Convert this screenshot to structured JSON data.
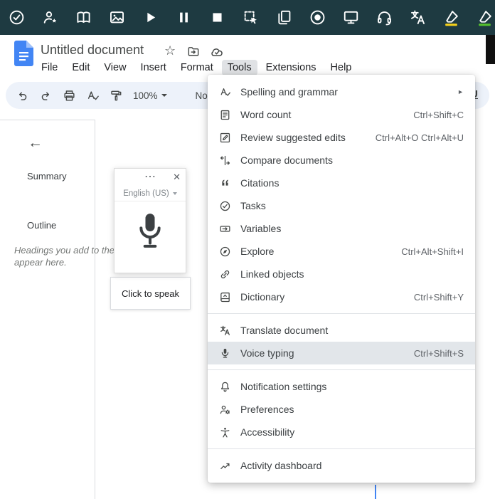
{
  "colors": {
    "topbar_bg": "#1e3a41",
    "docs_blue": "#4285f4",
    "toolbar_bg": "#edf2fa",
    "menu_item_highlight": "#e2e6ea",
    "active_menu_bg": "#e0e2e5",
    "highlighter_yellow": "#f7d21a",
    "highlighter_green": "#56c22d",
    "page_edge_blue": "#4285f4"
  },
  "top_toolbar": {
    "icons": [
      "check-circle-icon",
      "person-star-icon",
      "book-icon",
      "image-icon",
      "play-icon",
      "pause-icon",
      "stop-icon",
      "select-area-icon",
      "copy-icon",
      "record-icon",
      "monitor-icon",
      "headset-icon",
      "translate-icon",
      "highlighter-yellow-icon",
      "highlighter-green-icon"
    ]
  },
  "header": {
    "title": "Untitled document",
    "menu_items": [
      "File",
      "Edit",
      "View",
      "Insert",
      "Format",
      "Tools",
      "Extensions",
      "Help"
    ],
    "active_menu": "Tools"
  },
  "toolbar": {
    "zoom_value": "100%",
    "style_visible": "No",
    "underline_label": "U"
  },
  "sidebar": {
    "summary_label": "Summary",
    "outline_label": "Outline",
    "outline_hint": "Headings you add to the document will appear here.",
    "back_arrow": "←"
  },
  "voice_widget": {
    "menu_dots": "⋯",
    "close": "✕",
    "language": "English (US)",
    "tooltip": "Click to speak"
  },
  "tools_menu": {
    "sections": [
      {
        "items": [
          {
            "label": "Spelling and grammar",
            "icon": "spellcheck-icon",
            "submenu": true
          },
          {
            "label": "Word count",
            "icon": "word-count-icon",
            "shortcut": "Ctrl+Shift+C"
          },
          {
            "label": "Review suggested edits",
            "icon": "review-edits-icon",
            "shortcut": "Ctrl+Alt+O Ctrl+Alt+U"
          },
          {
            "label": "Compare documents",
            "icon": "compare-documents-icon"
          },
          {
            "label": "Citations",
            "icon": "citations-icon"
          },
          {
            "label": "Tasks",
            "icon": "tasks-icon"
          },
          {
            "label": "Variables",
            "icon": "variables-icon"
          },
          {
            "label": "Explore",
            "icon": "explore-icon",
            "shortcut": "Ctrl+Alt+Shift+I"
          },
          {
            "label": "Linked objects",
            "icon": "linked-objects-icon"
          },
          {
            "label": "Dictionary",
            "icon": "dictionary-icon",
            "shortcut": "Ctrl+Shift+Y"
          }
        ]
      },
      {
        "items": [
          {
            "label": "Translate document",
            "icon": "translate-icon"
          },
          {
            "label": "Voice typing",
            "icon": "microphone-icon",
            "shortcut": "Ctrl+Shift+S",
            "highlighted": true
          }
        ]
      },
      {
        "items": [
          {
            "label": "Notification settings",
            "icon": "bell-icon"
          },
          {
            "label": "Preferences",
            "icon": "preferences-icon"
          },
          {
            "label": "Accessibility",
            "icon": "accessibility-icon"
          }
        ]
      },
      {
        "items": [
          {
            "label": "Activity dashboard",
            "icon": "activity-dashboard-icon"
          }
        ]
      }
    ]
  }
}
